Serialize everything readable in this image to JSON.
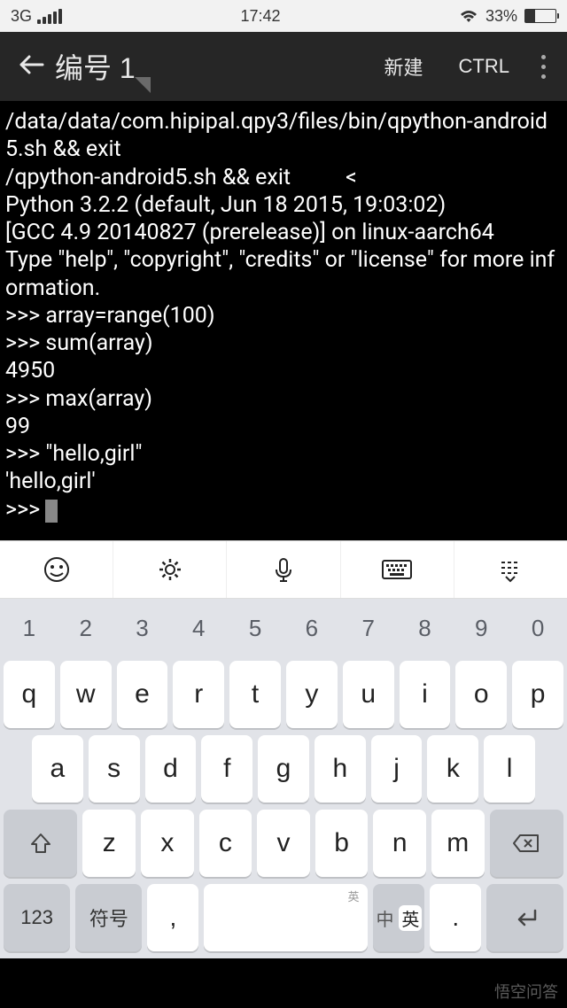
{
  "statusbar": {
    "network": "3G",
    "time": "17:42",
    "battery_pct": "33%"
  },
  "toolbar": {
    "title": "编号 1",
    "new_label": "新建",
    "ctrl_label": "CTRL"
  },
  "terminal": {
    "lines": [
      "/data/data/com.hipipal.qpy3/files/bin/qpython-android5.sh && exit",
      "/qpython-android5.sh && exit          <",
      "Python 3.2.2 (default, Jun 18 2015, 19:03:02)",
      "[GCC 4.9 20140827 (prerelease)] on linux-aarch64",
      "Type \"help\", \"copyright\", \"credits\" or \"license\" for more information.",
      ">>> array=range(100)",
      ">>> sum(array)",
      "4950",
      ">>> max(array)",
      "99",
      ">>> \"hello,girl\"",
      "'hello,girl'",
      ">>> "
    ]
  },
  "keyboard": {
    "numrow": [
      "1",
      "2",
      "3",
      "4",
      "5",
      "6",
      "7",
      "8",
      "9",
      "0"
    ],
    "row1": [
      "q",
      "w",
      "e",
      "r",
      "t",
      "y",
      "u",
      "i",
      "o",
      "p"
    ],
    "row2": [
      "a",
      "s",
      "d",
      "f",
      "g",
      "h",
      "j",
      "k",
      "l"
    ],
    "row3": [
      "z",
      "x",
      "c",
      "v",
      "b",
      "n",
      "m"
    ],
    "key_123": "123",
    "key_symbol": "符号",
    "key_comma": ",",
    "key_space_hint": "英",
    "key_period": ".",
    "lang_cn": "中",
    "lang_en": "英"
  },
  "watermark": "悟空问答"
}
